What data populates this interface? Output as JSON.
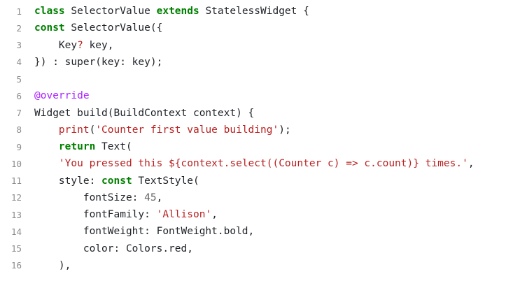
{
  "editor": {
    "lines": [
      {
        "n": "1",
        "tokens": [
          [
            "kw",
            "class"
          ],
          [
            "pl",
            " SelectorValue "
          ],
          [
            "kw",
            "extends"
          ],
          [
            "pl",
            " StatelessWidget {"
          ]
        ]
      },
      {
        "n": "2",
        "tokens": [
          [
            "kw",
            "const"
          ],
          [
            "pl",
            " SelectorValue({"
          ]
        ]
      },
      {
        "n": "3",
        "tokens": [
          [
            "pl",
            "    Key"
          ],
          [
            "str",
            "?"
          ],
          [
            "pl",
            " key,"
          ]
        ]
      },
      {
        "n": "4",
        "tokens": [
          [
            "pl",
            "}) : super(key: key);"
          ]
        ]
      },
      {
        "n": "5",
        "tokens": []
      },
      {
        "n": "6",
        "tokens": [
          [
            "dec",
            "@override"
          ]
        ]
      },
      {
        "n": "7",
        "tokens": [
          [
            "pl",
            "Widget build(BuildContext context) {"
          ]
        ]
      },
      {
        "n": "8",
        "tokens": [
          [
            "pl",
            "    "
          ],
          [
            "str",
            "print"
          ],
          [
            "pl",
            "("
          ],
          [
            "str",
            "'Counter first value building'"
          ],
          [
            "pl",
            ");"
          ]
        ]
      },
      {
        "n": "9",
        "tokens": [
          [
            "pl",
            "    "
          ],
          [
            "kw",
            "return"
          ],
          [
            "pl",
            " Text("
          ]
        ]
      },
      {
        "n": "10",
        "tokens": [
          [
            "pl",
            "    "
          ],
          [
            "str",
            "'You pressed this ${context.select((Counter c) => c.count)} times.'"
          ],
          [
            "pl",
            ","
          ]
        ]
      },
      {
        "n": "11",
        "tokens": [
          [
            "pl",
            "    style: "
          ],
          [
            "kw",
            "const"
          ],
          [
            "pl",
            " TextStyle("
          ]
        ]
      },
      {
        "n": "12",
        "tokens": [
          [
            "pl",
            "        fontSize: "
          ],
          [
            "num",
            "45"
          ],
          [
            "pl",
            ","
          ]
        ]
      },
      {
        "n": "13",
        "tokens": [
          [
            "pl",
            "        fontFamily: "
          ],
          [
            "str",
            "'Allison'"
          ],
          [
            "pl",
            ","
          ]
        ]
      },
      {
        "n": "14",
        "tokens": [
          [
            "pl",
            "        fontWeight: FontWeight.bold,"
          ]
        ]
      },
      {
        "n": "15",
        "tokens": [
          [
            "pl",
            "        color: Colors.red,"
          ]
        ]
      },
      {
        "n": "16",
        "tokens": [
          [
            "pl",
            "    ),"
          ]
        ]
      }
    ]
  }
}
